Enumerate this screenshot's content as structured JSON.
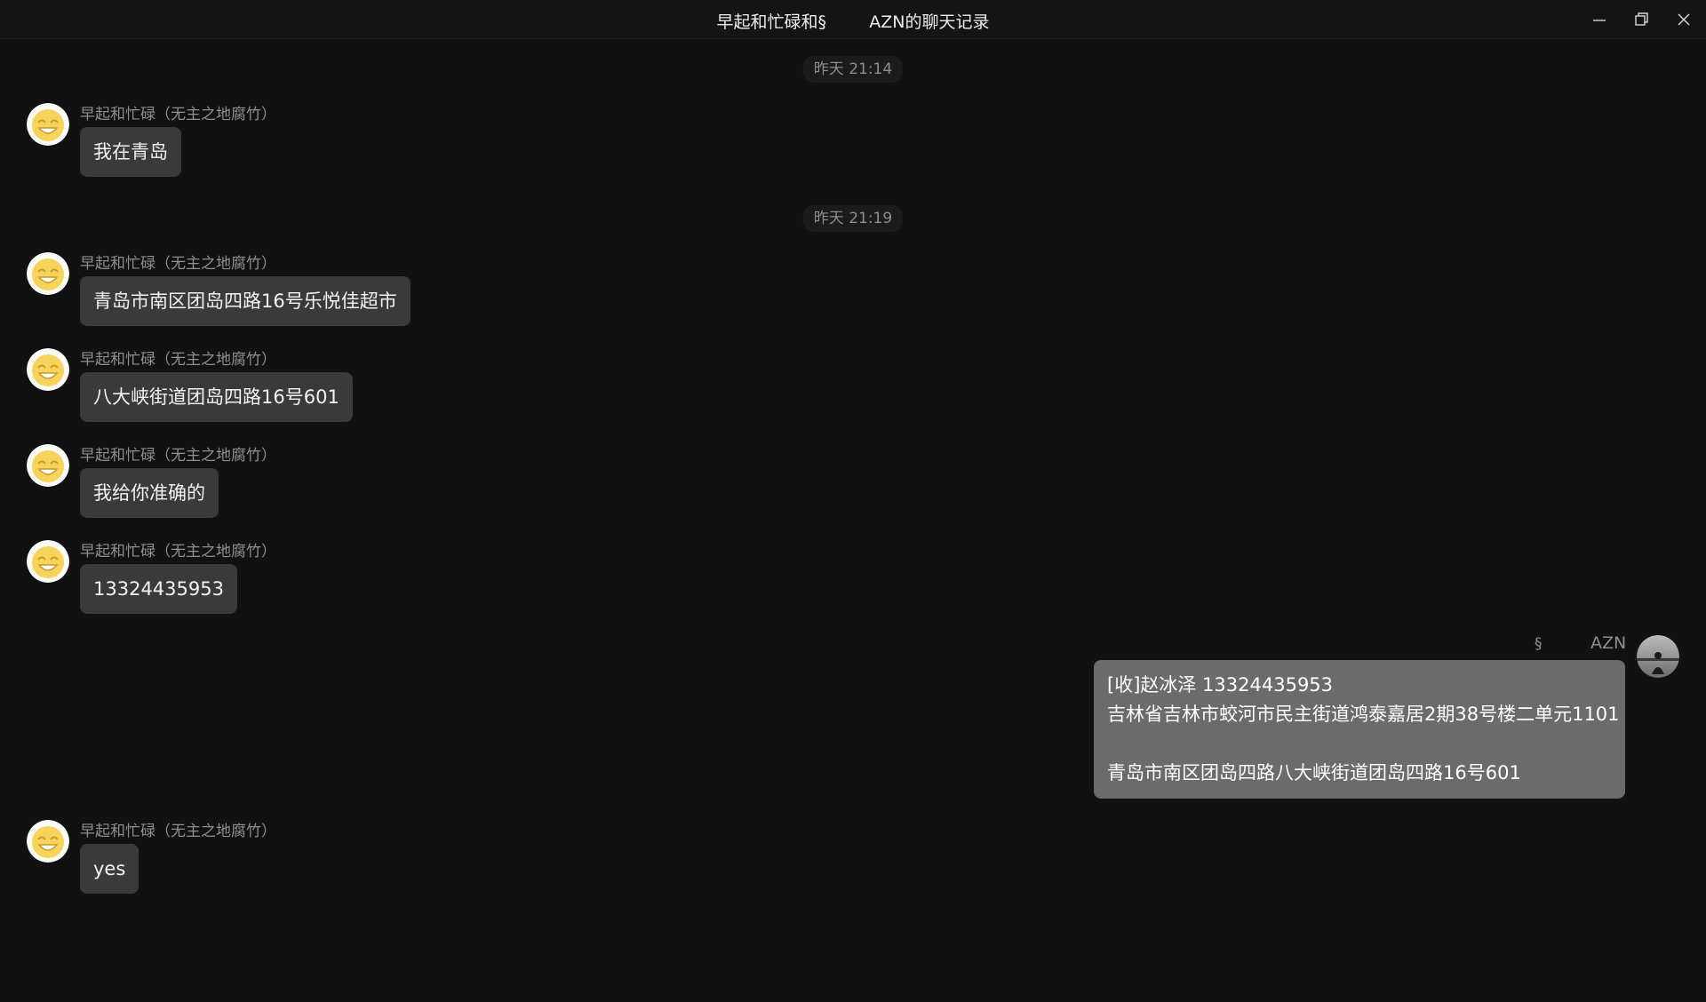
{
  "window": {
    "title": "早起和忙碌和§        AZN的聊天记录"
  },
  "icons": {
    "minimize": "minimize-icon",
    "restore": "restore-icon",
    "close": "close-icon",
    "contact_avatar": "smiley-face-avatar",
    "self_avatar": "silhouette-photo-avatar"
  },
  "colors": {
    "background": "#111111",
    "incoming_bubble": "#3a3a3a",
    "outgoing_bubble": "#6b6b6b",
    "meta_text": "#8f8f8f"
  },
  "contact": {
    "display_name": "早起和忙碌（无主之地腐竹）"
  },
  "self": {
    "sign": "§",
    "name": "AZN"
  },
  "timestamps": [
    "昨天 21:14",
    "昨天 21:19"
  ],
  "messages": [
    {
      "text": "我在青岛"
    },
    {
      "text": "青岛市南区团岛四路16号乐悦佳超市"
    },
    {
      "text": "八大峡街道团岛四路16号601"
    },
    {
      "text": "我给你准确的"
    },
    {
      "text": "13324435953"
    },
    {
      "text": "[收]赵冰泽 13324435953\n吉林省吉林市蛟河市民主街道鸿泰嘉居2期38号楼二单元1101\n\n青岛市南区团岛四路八大峡街道团岛四路16号601"
    },
    {
      "text": "yes"
    }
  ]
}
